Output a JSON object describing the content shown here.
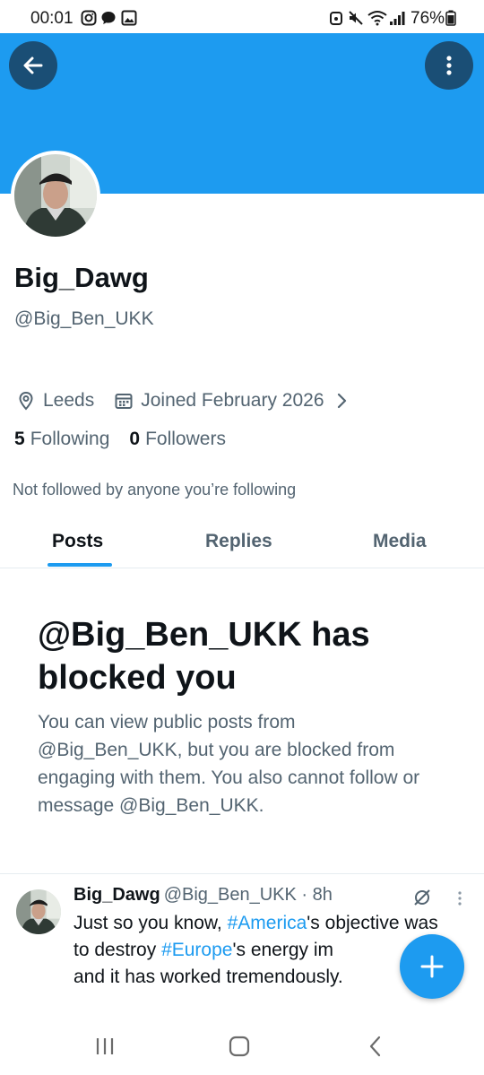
{
  "status_bar": {
    "time": "00:01",
    "battery": "76%"
  },
  "profile": {
    "name": "Big_Dawg",
    "handle": "@Big_Ben_UKK",
    "location": "Leeds",
    "joined": "Joined February 2026",
    "following_count": "5",
    "following_label": "Following",
    "followers_count": "0",
    "followers_label": "Followers",
    "not_followed_note": "Not followed by anyone you’re following"
  },
  "tabs": [
    {
      "label": "Posts",
      "active": true
    },
    {
      "label": "Replies",
      "active": false
    },
    {
      "label": "Media",
      "active": false
    }
  ],
  "blocked": {
    "title": "@Big_Ben_UKK has blocked you",
    "body": "You can view public posts from @Big_Ben_UKK, but you are blocked from engaging with them. You also cannot follow or message @Big_Ben_UKK."
  },
  "post": {
    "author": "Big_Dawg",
    "meta": "@Big_Ben_UKK · 8h",
    "text_1": "Just so you know, ",
    "tag_1": "#America",
    "text_2": "'s objective was to destroy ",
    "tag_2": "#Europe",
    "text_3": "'s energy im",
    "text_4": "and it has worked tremendously."
  },
  "colors": {
    "accent": "#1d9bf0",
    "banner_button": "#1a4e75",
    "secondary_text": "#536471"
  },
  "icons": {
    "back": "arrow-left-icon",
    "more": "more-vertical-icon",
    "location": "location-pin-icon",
    "calendar": "calendar-icon",
    "chevron": "chevron-right-icon",
    "grok": "grok-icon",
    "compose": "plus-icon"
  }
}
